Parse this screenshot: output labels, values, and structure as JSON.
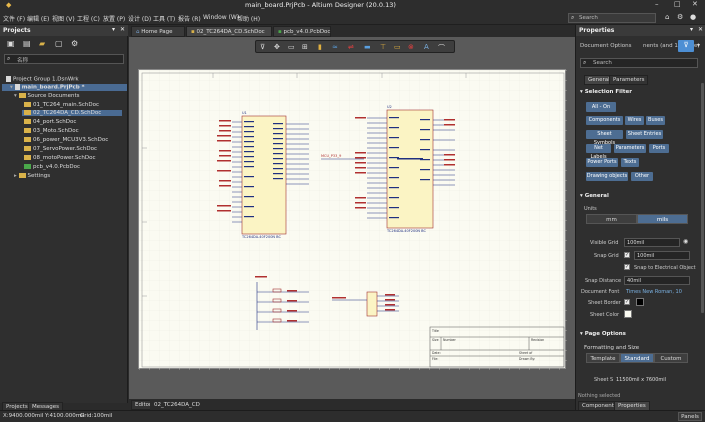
{
  "window": {
    "title": "main_board.PrjPcb - Altium Designer (20.0.13)"
  },
  "menu": {
    "items": [
      "文件 (F)",
      "编辑 (E)",
      "视图 (V)",
      "工程 (C)",
      "放置 (P)",
      "设计 (D)",
      "工具 (T)",
      "报告 (R)",
      "Window (W)",
      "帮助 (H)"
    ],
    "search_placeholder": "Search"
  },
  "projects": {
    "title": "Projects",
    "search_placeholder": "名称",
    "group": "Project Group 1.DsnWrk",
    "project": "main_board.PrjPcb *",
    "source_folder": "Source Documents",
    "files": [
      "01_TC264_main.SchDoc",
      "02_TC264DA_CD.SchDoc",
      "04_port.SchDoc",
      "03_Moto.SchDoc",
      "06_power_MCU3V3.SchDoc",
      "07_ServoPower.SchDoc",
      "08_motoPower.SchDoc",
      "pcb_v4.0.PcbDoc"
    ],
    "settings": "Settings",
    "bottom_tabs": [
      "Projects",
      "Messages"
    ]
  },
  "doc_tabs": [
    "Home Page",
    "02_TC264DA_CD.SchDoc",
    "pcb_v4.0.PcbDoc"
  ],
  "editor_tabs": [
    "Editor",
    "02_TC264DA_CD"
  ],
  "schematic": {
    "u1_ref": "U1",
    "u1_value": "TC264DA-40F200N BC",
    "u2_ref": "U2",
    "u2_value": "TC264DA-40F200N BC",
    "net_label": "MCU_P33_9",
    "title_block": {
      "title": "Title",
      "size": "Size",
      "number": "Number",
      "revision": "Revision",
      "date": "Date:",
      "file": "File:",
      "sheet": "Sheet of",
      "drawn": "Drawn By:"
    }
  },
  "properties": {
    "title": "Properties",
    "doc_options": "Document Options",
    "filter_text": "nents (and 11 more)",
    "search_placeholder": "Search",
    "tabs": [
      "General",
      "Parameters"
    ],
    "selection_filter_title": "Selection Filter",
    "all_on": "All - On",
    "filters": [
      "Components",
      "Wires",
      "Buses",
      "Sheet Symbols",
      "Sheet Entries",
      "Net Labels",
      "Parameters",
      "Ports",
      "Power Ports",
      "Texts",
      "Drawing objects",
      "Other"
    ],
    "general_title": "General",
    "units_label": "Units",
    "units": [
      "mm",
      "mils"
    ],
    "visible_grid_label": "Visible Grid",
    "visible_grid_value": "100mil",
    "snap_grid_label": "Snap Grid",
    "snap_grid_value": "100mil",
    "snap_elec_label": "Snap to Electrical Object",
    "snap_distance_label": "Snap Distance",
    "snap_distance_value": "40mil",
    "doc_font_label": "Document Font",
    "doc_font_value": "Times New Roman, 10",
    "sheet_border_label": "Sheet Border",
    "sheet_color_label": "Sheet Color",
    "page_options_title": "Page Options",
    "format_label": "Formatting and Size",
    "format_options": [
      "Template",
      "Standard",
      "Custom"
    ],
    "sheet_size_label": "Sheet Size",
    "sheet_size_value": "11500mil x 7600mil",
    "status": "Nothing selected",
    "bottom_tabs": [
      "Components",
      "Properties"
    ]
  },
  "status": {
    "coords": "X:9400.000mil Y:4100.000mil",
    "grid": "Grid:100mil",
    "panels": "Panels"
  }
}
